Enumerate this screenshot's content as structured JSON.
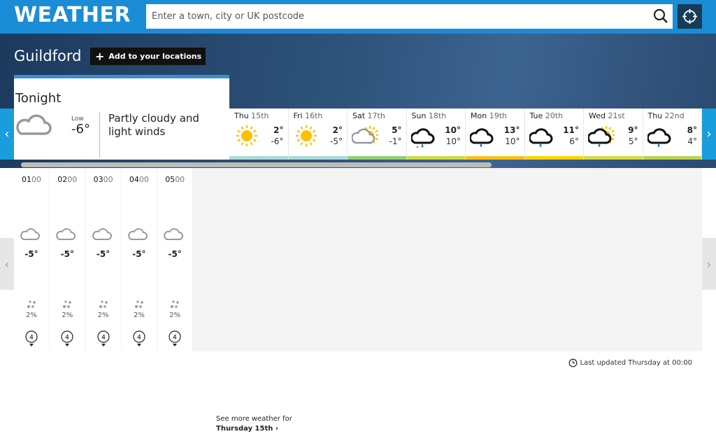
{
  "header": {
    "logo": "WEATHER",
    "search_placeholder": "Enter a town, city or UK postcode"
  },
  "location": {
    "name": "Guildford",
    "add_label": "Add to your locations"
  },
  "tonight": {
    "title": "Tonight",
    "low_label": "Low",
    "low": "-6°",
    "description": "Partly cloudy and light winds",
    "icon": "partly-cloudy-night"
  },
  "days": [
    {
      "dow": "Thu",
      "date": "15th",
      "hi": "2°",
      "lo": "-6°",
      "icon": "sunny",
      "bar": "#a9dcd6"
    },
    {
      "dow": "Fri",
      "date": "16th",
      "hi": "2°",
      "lo": "-5°",
      "icon": "sunny",
      "bar": "#a9dcd6"
    },
    {
      "dow": "Sat",
      "date": "17th",
      "hi": "5°",
      "lo": "-1°",
      "icon": "sunny-intervals",
      "bar": "#93cf72"
    },
    {
      "dow": "Sun",
      "date": "18th",
      "hi": "10°",
      "lo": "10°",
      "icon": "heavy-rain",
      "bar": "#cbdc3f"
    },
    {
      "dow": "Mon",
      "date": "19th",
      "hi": "13°",
      "lo": "10°",
      "icon": "light-rain",
      "bar": "#fdc211"
    },
    {
      "dow": "Tue",
      "date": "20th",
      "hi": "11°",
      "lo": "6°",
      "icon": "light-rain",
      "bar": "#fdd500"
    },
    {
      "dow": "Wed",
      "date": "21st",
      "hi": "9°",
      "lo": "5°",
      "icon": "light-rain-sun",
      "bar": "#d5dc3e"
    },
    {
      "dow": "Thu",
      "date": "22nd",
      "hi": "8°",
      "lo": "4°",
      "icon": "light-rain",
      "bar": "#b8d54c"
    }
  ],
  "hourly": [
    {
      "hh": "01",
      "mm": "00",
      "temp": "-5°",
      "rain": "2%",
      "wind": "4"
    },
    {
      "hh": "02",
      "mm": "00",
      "temp": "-5°",
      "rain": "2%",
      "wind": "4"
    },
    {
      "hh": "03",
      "mm": "00",
      "temp": "-5°",
      "rain": "2%",
      "wind": "4"
    },
    {
      "hh": "04",
      "mm": "00",
      "temp": "-5°",
      "rain": "2%",
      "wind": "4"
    },
    {
      "hh": "05",
      "mm": "00",
      "temp": "-5°",
      "rain": "2%",
      "wind": "4"
    }
  ],
  "more": {
    "line1": "See more weather for",
    "line2": "Thursday 15th"
  },
  "footer": {
    "updated": "Last updated Thursday at 00:00"
  }
}
